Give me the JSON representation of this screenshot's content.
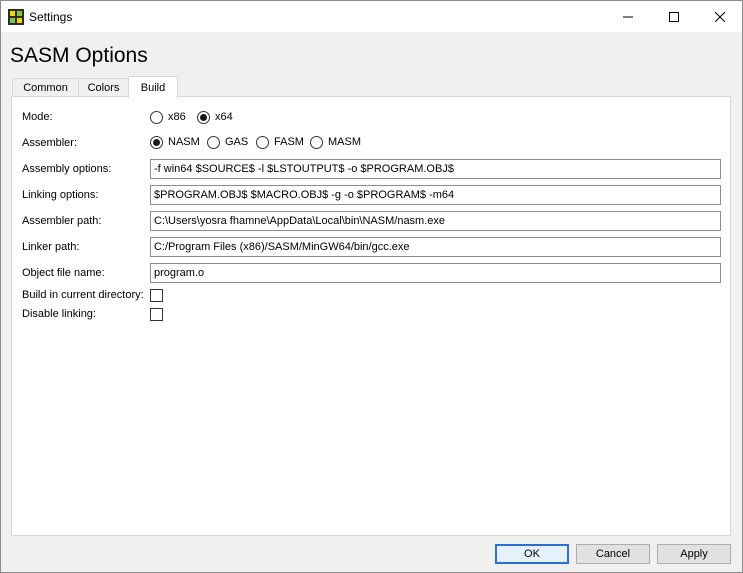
{
  "window": {
    "title": "Settings"
  },
  "heading": "SASM Options",
  "tabs": [
    {
      "label": "Common"
    },
    {
      "label": "Colors"
    },
    {
      "label": "Build",
      "active": true
    }
  ],
  "build": {
    "mode": {
      "label": "Mode:",
      "options": [
        "x86",
        "x64"
      ],
      "selected": "x64"
    },
    "assembler": {
      "label": "Assembler:",
      "options": [
        "NASM",
        "GAS",
        "FASM",
        "MASM"
      ],
      "selected": "NASM"
    },
    "assembly_options": {
      "label": "Assembly options:",
      "value": "-f win64 $SOURCE$ -l $LSTOUTPUT$ -o $PROGRAM.OBJ$"
    },
    "linking_options": {
      "label": "Linking options:",
      "value": "$PROGRAM.OBJ$ $MACRO.OBJ$ -g -o $PROGRAM$ -m64"
    },
    "assembler_path": {
      "label": "Assembler path:",
      "value": "C:\\Users\\yosra fhamne\\AppData\\Local\\bin\\NASM/nasm.exe"
    },
    "linker_path": {
      "label": "Linker path:",
      "value": "C:/Program Files (x86)/SASM/MinGW64/bin/gcc.exe"
    },
    "object_file_name": {
      "label": "Object file name:",
      "value": "program.o"
    },
    "build_in_current_dir": {
      "label": "Build in current directory:",
      "checked": false
    },
    "disable_linking": {
      "label": "Disable linking:",
      "checked": false
    }
  },
  "buttons": {
    "ok": "OK",
    "cancel": "Cancel",
    "apply": "Apply"
  }
}
